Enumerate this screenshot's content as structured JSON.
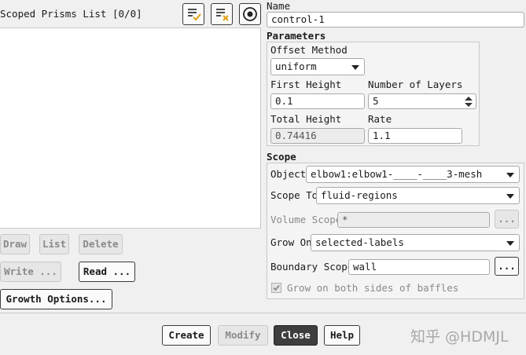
{
  "left": {
    "list_title": "Scoped Prisms List [0/0]",
    "buttons": {
      "draw": "Draw",
      "list": "List",
      "delete": "Delete",
      "write": "Write ...",
      "read": "Read ...",
      "growth_options": "Growth Options..."
    }
  },
  "name": {
    "label": "Name",
    "value": "control-1"
  },
  "parameters": {
    "title": "Parameters",
    "offset_method_label": "Offset Method",
    "offset_method_value": "uniform",
    "first_height_label": "First Height",
    "first_height_value": "0.1",
    "num_layers_label": "Number of Layers",
    "num_layers_value": "5",
    "total_height_label": "Total Height",
    "total_height_value": "0.74416",
    "rate_label": "Rate",
    "rate_value": "1.1"
  },
  "scope": {
    "title": "Scope",
    "object_label": "Object",
    "object_value": "elbow1:elbow1-____-____3-mesh",
    "scope_to_label": "Scope To",
    "scope_to_value": "fluid-regions",
    "volume_scope_label": "Volume Scope",
    "volume_scope_value": "*",
    "grow_on_label": "Grow On",
    "grow_on_value": "selected-labels",
    "boundary_scope_label": "Boundary Scope",
    "boundary_scope_value": "wall",
    "ellipsis": "...",
    "baffles_label": "Grow on both sides of baffles",
    "baffles_checked": true
  },
  "footer": {
    "create": "Create",
    "modify": "Modify",
    "close": "Close",
    "help": "Help"
  },
  "watermark": "知乎 @HDMJL"
}
